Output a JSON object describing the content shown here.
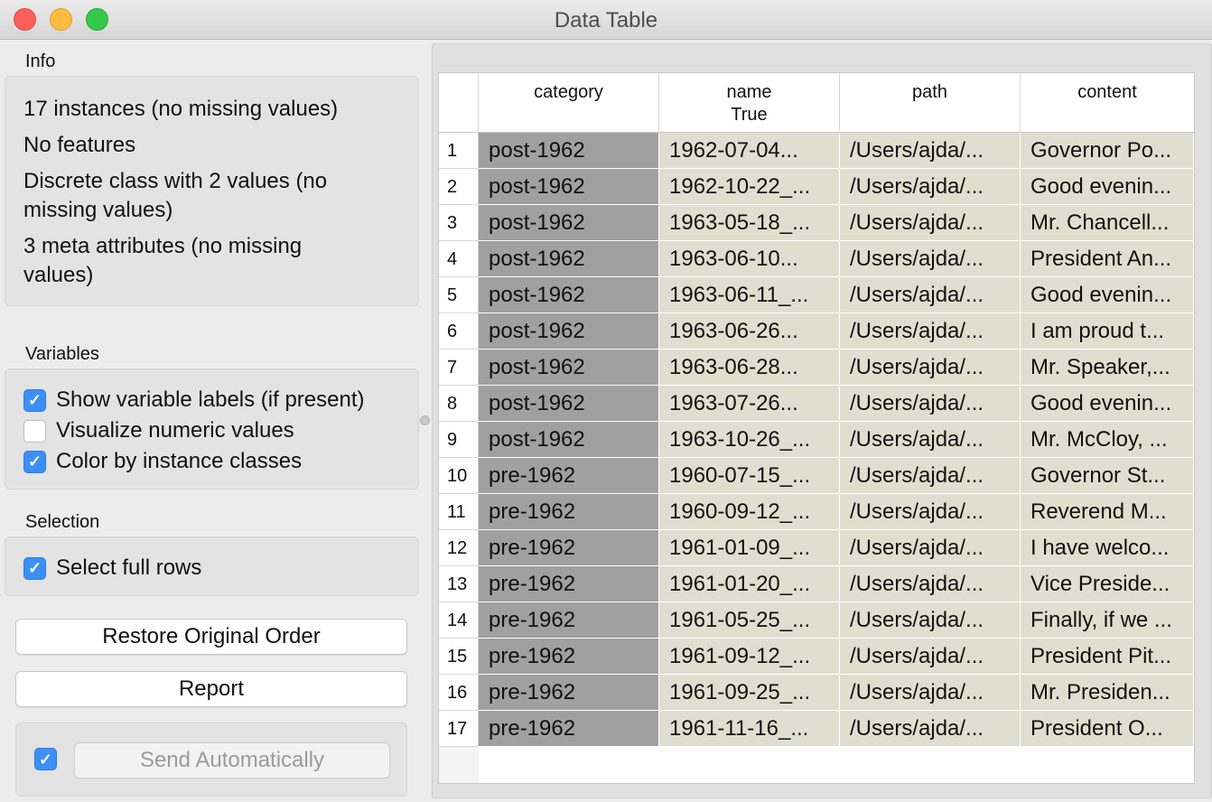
{
  "window": {
    "title": "Data Table"
  },
  "info": {
    "section_label": "Info",
    "lines": [
      "17 instances (no missing values)",
      "No features",
      "Discrete class with 2 values (no",
      "missing values)",
      "3 meta attributes (no missing",
      "values)"
    ]
  },
  "variables": {
    "section_label": "Variables",
    "show_labels": {
      "label": "Show variable labels (if present)",
      "checked": true
    },
    "visualize_numeric": {
      "label": "Visualize numeric values",
      "checked": false
    },
    "color_by_class": {
      "label": "Color by instance classes",
      "checked": true
    }
  },
  "selection": {
    "section_label": "Selection",
    "select_full_rows": {
      "label": "Select full rows",
      "checked": true
    }
  },
  "buttons": {
    "restore_label": "Restore Original Order",
    "report_label": "Report",
    "send_label": "Send Automatically",
    "send_checked": true
  },
  "checkmark": "✓",
  "table": {
    "columns": [
      {
        "name": "category",
        "sub": ""
      },
      {
        "name": "name",
        "sub": "True"
      },
      {
        "name": "path",
        "sub": ""
      },
      {
        "name": "content",
        "sub": ""
      }
    ],
    "rows": [
      [
        "1",
        "post-1962",
        "1962-07-04...",
        "/Users/ajda/...",
        "Governor Po..."
      ],
      [
        "2",
        "post-1962",
        "1962-10-22_...",
        "/Users/ajda/...",
        "Good evenin..."
      ],
      [
        "3",
        "post-1962",
        "1963-05-18_...",
        "/Users/ajda/...",
        "Mr. Chancell..."
      ],
      [
        "4",
        "post-1962",
        "1963-06-10...",
        "/Users/ajda/...",
        "President An..."
      ],
      [
        "5",
        "post-1962",
        "1963-06-11_...",
        "/Users/ajda/...",
        "Good evenin..."
      ],
      [
        "6",
        "post-1962",
        "1963-06-26...",
        "/Users/ajda/...",
        "I am proud t..."
      ],
      [
        "7",
        "post-1962",
        "1963-06-28...",
        "/Users/ajda/...",
        "Mr. Speaker,..."
      ],
      [
        "8",
        "post-1962",
        "1963-07-26...",
        "/Users/ajda/...",
        "Good evenin..."
      ],
      [
        "9",
        "post-1962",
        "1963-10-26_...",
        "/Users/ajda/...",
        "Mr. McCloy, ..."
      ],
      [
        "10",
        "pre-1962",
        "1960-07-15_...",
        "/Users/ajda/...",
        "Governor St..."
      ],
      [
        "11",
        "pre-1962",
        "1960-09-12_...",
        "/Users/ajda/...",
        "Reverend M..."
      ],
      [
        "12",
        "pre-1962",
        "1961-01-09_...",
        "/Users/ajda/...",
        "I have welco..."
      ],
      [
        "13",
        "pre-1962",
        "1961-01-20_...",
        "/Users/ajda/...",
        "Vice Preside..."
      ],
      [
        "14",
        "pre-1962",
        "1961-05-25_...",
        "/Users/ajda/...",
        "Finally, if we ..."
      ],
      [
        "15",
        "pre-1962",
        "1961-09-12_...",
        "/Users/ajda/...",
        "President Pit..."
      ],
      [
        "16",
        "pre-1962",
        "1961-09-25_...",
        "/Users/ajda/...",
        "Mr. Presiden..."
      ],
      [
        "17",
        "pre-1962",
        "1961-11-16_...",
        "/Users/ajda/...",
        "President O..."
      ]
    ]
  },
  "colors": {
    "class_column": "#a0a0a0",
    "meta_column": "#dfdfcf",
    "checkbox_accent": "#3b8ff7"
  }
}
